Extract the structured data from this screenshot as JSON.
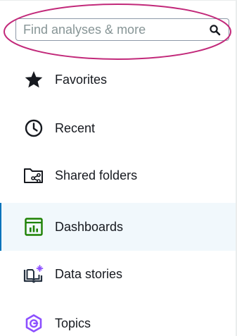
{
  "search": {
    "placeholder": "Find analyses & more",
    "value": "",
    "icon": "search-icon"
  },
  "annotation": {
    "highlight_color": "#c2297a"
  },
  "nav": {
    "active_color": "#0073bb",
    "items": [
      {
        "label": "Favorites",
        "icon": "star-icon",
        "active": false
      },
      {
        "label": "Recent",
        "icon": "clock-icon",
        "active": false
      },
      {
        "label": "Shared folders",
        "icon": "shared-folder-icon",
        "active": false
      },
      {
        "label": "Dashboards",
        "icon": "dashboard-icon",
        "active": true,
        "icon_color": "#1d8102"
      },
      {
        "label": "Data stories",
        "icon": "data-stories-icon",
        "active": false,
        "icon_color": "#232f3e"
      },
      {
        "label": "Topics",
        "icon": "topics-icon",
        "active": false,
        "icon_color": "#8c4fff"
      }
    ]
  }
}
